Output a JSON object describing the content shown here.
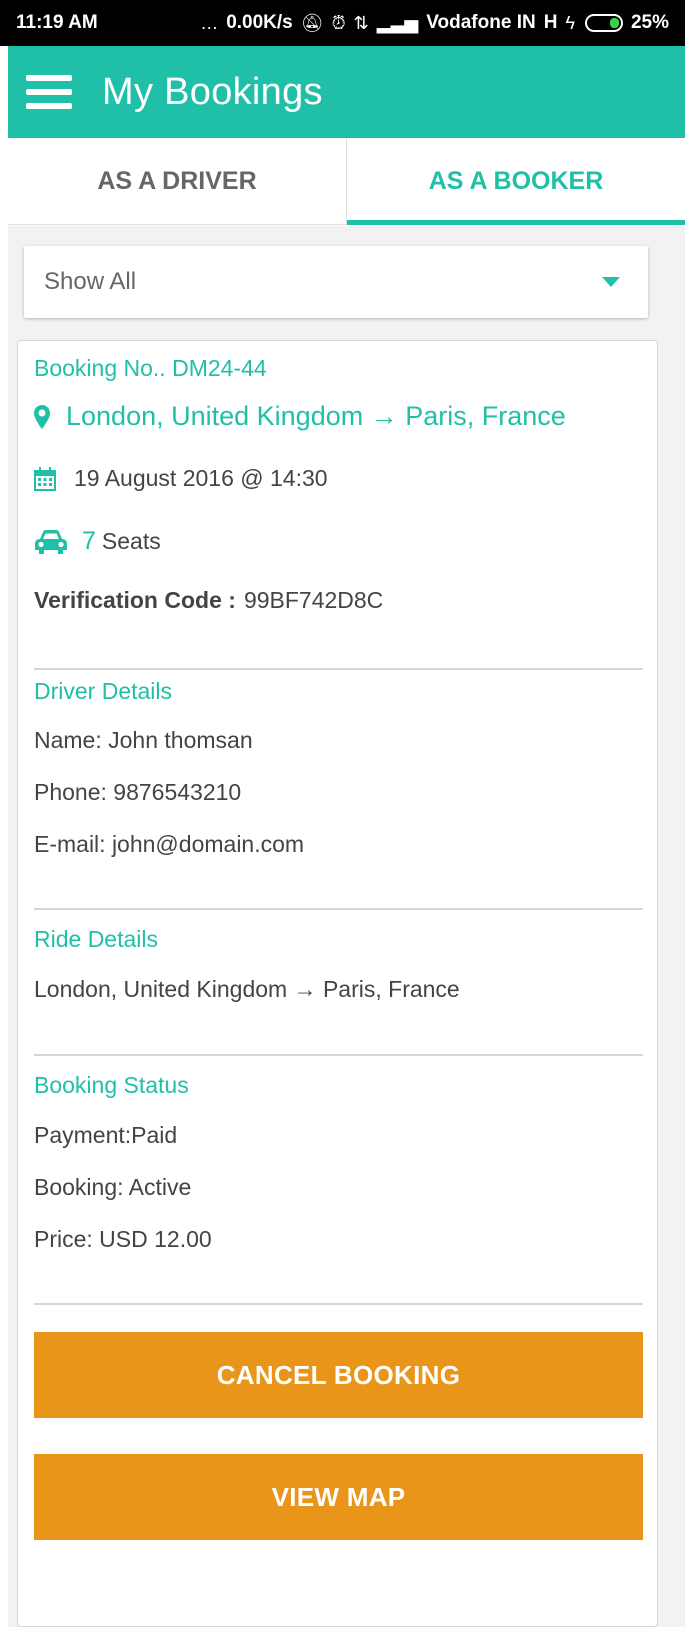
{
  "status_bar": {
    "time": "11:19 AM",
    "network_speed": "0.00K/s",
    "carrier": "Vodafone IN",
    "network_type": "H",
    "battery": "25%"
  },
  "app_bar": {
    "title": "My Bookings",
    "menu_icon": "hamburger-menu-icon"
  },
  "tabs": [
    {
      "label": "AS A DRIVER",
      "active": false
    },
    {
      "label": "AS A BOOKER",
      "active": true
    }
  ],
  "filter": {
    "selected": "Show All"
  },
  "booking": {
    "number_label": "Booking No.. DM24-44",
    "route": "London, United Kingdom → Paris, France",
    "date": "19 August 2016 @ 14:30",
    "seats_count": "7",
    "seats_label": "Seats",
    "verification_label": "Verification Code :",
    "verification_code": "99BF742D8C"
  },
  "driver_details": {
    "title": "Driver Details",
    "name": "Name: John thomsan",
    "phone": "Phone: 9876543210",
    "email": "E-mail: john@domain.com"
  },
  "ride_details": {
    "title": "Ride Details",
    "route": "London, United Kingdom → Paris, France"
  },
  "booking_status": {
    "title": "Booking Status",
    "payment": "Payment:Paid",
    "booking": "Booking: Active",
    "price": "Price: USD 12.00"
  },
  "actions": {
    "cancel_label": "CANCEL BOOKING",
    "map_label": "VIEW MAP"
  },
  "colors": {
    "accent": "#20bfa7",
    "button": "#e8951a"
  }
}
